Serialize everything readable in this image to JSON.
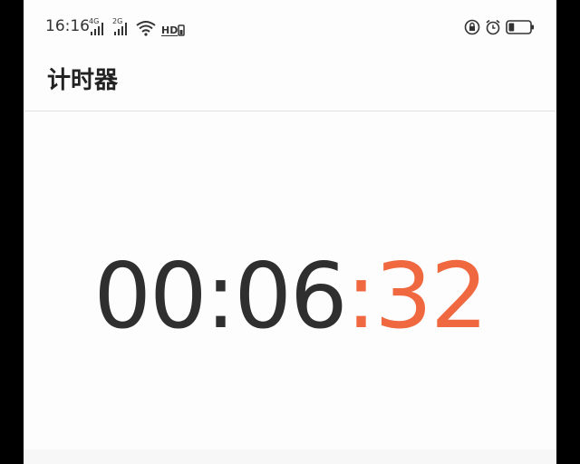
{
  "status_bar": {
    "time": "16:16",
    "signal_1_tag": "4G",
    "signal_2_tag": "2G",
    "hd_label": "HD",
    "icons": [
      "signal-icon",
      "signal-icon",
      "wifi-icon",
      "hd-icon",
      "rotation-lock-icon",
      "alarm-icon",
      "battery-icon"
    ],
    "battery_level": 0.25
  },
  "header": {
    "title": "计时器"
  },
  "timer": {
    "hours": "00",
    "sep1": ":",
    "minutes": "06",
    "sep2": ":",
    "seconds": "32"
  },
  "colors": {
    "accent": "#f0683f",
    "text": "#2f2f2f",
    "background": "#fdfdfd"
  }
}
